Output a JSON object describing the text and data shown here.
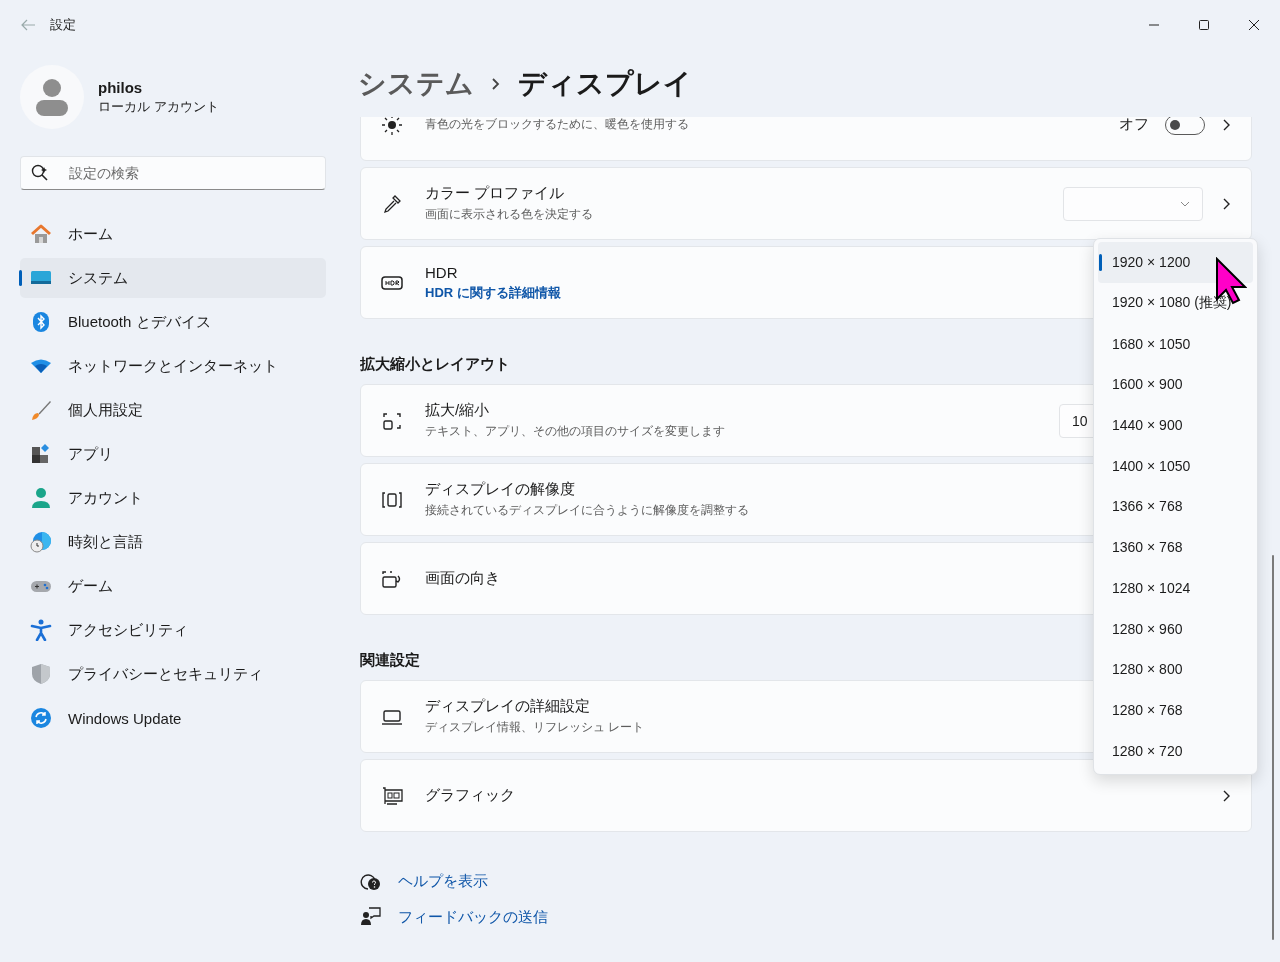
{
  "window": {
    "title": "設定"
  },
  "account": {
    "name": "philos",
    "type": "ローカル アカウント"
  },
  "search": {
    "placeholder": "設定の検索"
  },
  "nav": [
    {
      "label": "ホーム",
      "selected": false
    },
    {
      "label": "システム",
      "selected": true
    },
    {
      "label": "Bluetooth とデバイス",
      "selected": false
    },
    {
      "label": "ネットワークとインターネット",
      "selected": false
    },
    {
      "label": "個人用設定",
      "selected": false
    },
    {
      "label": "アプリ",
      "selected": false
    },
    {
      "label": "アカウント",
      "selected": false
    },
    {
      "label": "時刻と言語",
      "selected": false
    },
    {
      "label": "ゲーム",
      "selected": false
    },
    {
      "label": "アクセシビリティ",
      "selected": false
    },
    {
      "label": "プライバシーとセキュリティ",
      "selected": false
    },
    {
      "label": "Windows Update",
      "selected": false
    }
  ],
  "breadcrumb": {
    "parent": "システム",
    "current": "ディスプレイ"
  },
  "groups": [
    {
      "cards": [
        {
          "kind": "toggle",
          "subtitle": "青色の光をブロックするために、暖色を使用する",
          "status": "オフ",
          "on": false,
          "chevron": true
        },
        {
          "kind": "dropdown",
          "title": "カラー プロファイル",
          "subtitle": "画面に表示される色を決定する",
          "arrow": true,
          "chevron": true
        },
        {
          "kind": "link",
          "title": "HDR",
          "link": "HDR に関する詳細情報"
        }
      ]
    },
    {
      "heading": "拡大縮小とレイアウト",
      "cards": [
        {
          "kind": "dropdown",
          "title": "拡大/縮小",
          "subtitle": "テキスト、アプリ、その他の項目のサイズを変更します",
          "value": "10"
        },
        {
          "kind": "plain",
          "title": "ディスプレイの解像度",
          "subtitle": "接続されているディスプレイに合うように解像度を調整する"
        },
        {
          "kind": "plain",
          "title": "画面の向き"
        }
      ]
    },
    {
      "heading": "関連設定",
      "cards": [
        {
          "kind": "plain",
          "title": "ディスプレイの詳細設定",
          "subtitle": "ディスプレイ情報、リフレッシュ レート"
        },
        {
          "kind": "plain",
          "title": "グラフィック",
          "chevron": true
        }
      ]
    }
  ],
  "help_links": [
    {
      "label": "ヘルプを表示"
    },
    {
      "label": "フィードバックの送信"
    }
  ],
  "resolution_menu": [
    {
      "label": "1920 × 1200",
      "selected": true
    },
    {
      "label": "1920 × 1080 (推奨)",
      "selected": false
    },
    {
      "label": "1680 × 1050",
      "selected": false
    },
    {
      "label": "1600 × 900",
      "selected": false
    },
    {
      "label": "1440 × 900",
      "selected": false
    },
    {
      "label": "1400 × 1050",
      "selected": false
    },
    {
      "label": "1366 × 768",
      "selected": false
    },
    {
      "label": "1360 × 768",
      "selected": false
    },
    {
      "label": "1280 × 1024",
      "selected": false
    },
    {
      "label": "1280 × 960",
      "selected": false
    },
    {
      "label": "1280 × 800",
      "selected": false
    },
    {
      "label": "1280 × 768",
      "selected": false
    },
    {
      "label": "1280 × 720",
      "selected": false
    }
  ]
}
